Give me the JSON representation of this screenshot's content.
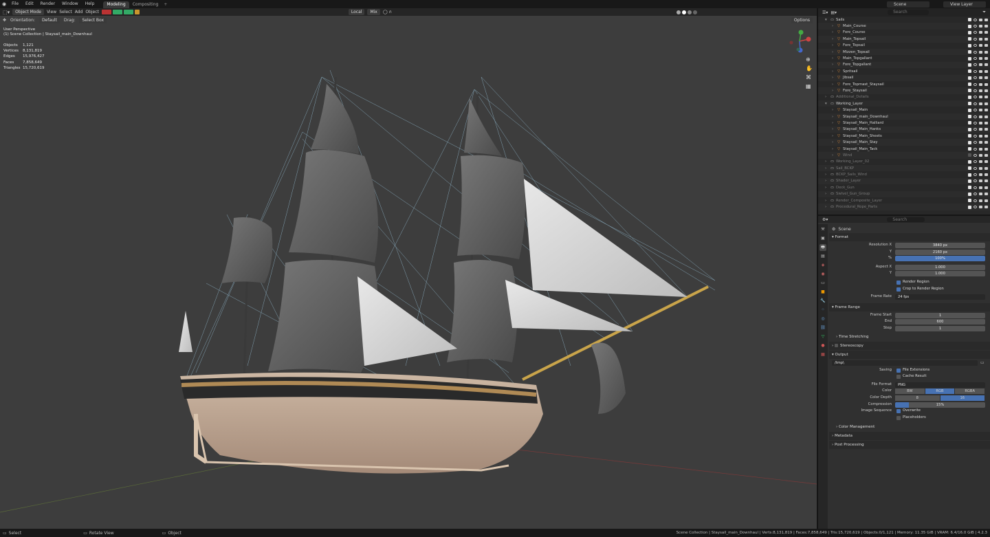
{
  "menubar": {
    "items": [
      "File",
      "Edit",
      "Render",
      "Window",
      "Help"
    ],
    "tabs": [
      "Modeling",
      "Compositing"
    ],
    "active_tab": "Modeling",
    "scene": "Scene",
    "view_layer": "View Layer"
  },
  "viewport_header": {
    "mode": "Object Mode",
    "menus": [
      "View",
      "Select",
      "Add",
      "Object"
    ],
    "transform": "Local",
    "pivot": "Mix",
    "orientation_label": "Orientation:",
    "orientation": "Default",
    "drag_label": "Drag:",
    "drag": "Select Box",
    "options": "Options"
  },
  "overlay": {
    "perspective": "User Perspective",
    "collection": "(1) Scene Collection | Staysail_main_Downhaul"
  },
  "stats": [
    {
      "k": "Objects",
      "v": "1,121"
    },
    {
      "k": "Vertices",
      "v": "8,131,819"
    },
    {
      "k": "Edges",
      "v": "15,976,427"
    },
    {
      "k": "Faces",
      "v": "7,858,649"
    },
    {
      "k": "Triangles",
      "v": "15,720,619"
    }
  ],
  "outliner": {
    "search_placeholder": "Search",
    "rows": [
      {
        "label": "Sails",
        "indent": 1,
        "dim": false
      },
      {
        "label": "Main_Course",
        "indent": 2,
        "dim": false
      },
      {
        "label": "Fore_Course",
        "indent": 2,
        "dim": false
      },
      {
        "label": "Main_Topsail",
        "indent": 2,
        "dim": false
      },
      {
        "label": "Fore_Topsail",
        "indent": 2,
        "dim": false
      },
      {
        "label": "Mizzen_Topsail",
        "indent": 2,
        "dim": false
      },
      {
        "label": "Main_Topgallant",
        "indent": 2,
        "dim": false
      },
      {
        "label": "Fore_Topgallant",
        "indent": 2,
        "dim": false
      },
      {
        "label": "Spritsail",
        "indent": 2,
        "dim": false
      },
      {
        "label": "Jibsail",
        "indent": 2,
        "dim": false
      },
      {
        "label": "Fore_Topmast_Staysail",
        "indent": 2,
        "dim": false
      },
      {
        "label": "Fore_Staysail",
        "indent": 2,
        "dim": false
      },
      {
        "label": "Additional_Details",
        "indent": 1,
        "dim": true
      },
      {
        "label": "Working_Layer",
        "indent": 1,
        "dim": false
      },
      {
        "label": "Staysail_Main",
        "indent": 2,
        "dim": false
      },
      {
        "label": "Staysail_main_Downhaul",
        "indent": 2,
        "dim": false
      },
      {
        "label": "Staysail_Main_Halliard",
        "indent": 2,
        "dim": false
      },
      {
        "label": "Staysail_Main_Hanks",
        "indent": 2,
        "dim": false
      },
      {
        "label": "Staysail_Main_Sheets",
        "indent": 2,
        "dim": false
      },
      {
        "label": "Staysail_Main_Stay",
        "indent": 2,
        "dim": false
      },
      {
        "label": "Staysail_Main_Tack",
        "indent": 2,
        "dim": false
      },
      {
        "label": "Wind",
        "indent": 2,
        "dim": true
      },
      {
        "label": "Working_Layer_02",
        "indent": 1,
        "dim": true
      },
      {
        "label": "Sail_BCKP",
        "indent": 1,
        "dim": true
      },
      {
        "label": "BCKP_Sails_Wind",
        "indent": 1,
        "dim": true
      },
      {
        "label": "Shader_Layer",
        "indent": 1,
        "dim": true
      },
      {
        "label": "Deck_Gun",
        "indent": 1,
        "dim": true
      },
      {
        "label": "Swivel_Gun_Group",
        "indent": 1,
        "dim": true
      },
      {
        "label": "Render_Composite_Layer",
        "indent": 1,
        "dim": true
      },
      {
        "label": "Procedural_Rope_Parts",
        "indent": 1,
        "dim": true
      }
    ]
  },
  "properties": {
    "search_placeholder": "Search",
    "scene": "Scene",
    "format": {
      "title": "Format",
      "res_x_label": "Resolution X",
      "res_x": "3840 px",
      "res_y_label": "Y",
      "res_y": "2160 px",
      "pct_label": "%",
      "pct": "100%",
      "aspect_x_label": "Aspect X",
      "aspect_x": "1.000",
      "aspect_y_label": "Y",
      "aspect_y": "1.000",
      "render_region": "Render Region",
      "crop": "Crop to Render Region",
      "frame_rate_label": "Frame Rate",
      "frame_rate": "24 fps"
    },
    "frame_range": {
      "title": "Frame Range",
      "start_label": "Frame Start",
      "start": "1",
      "end_label": "End",
      "end": "600",
      "step_label": "Step",
      "step": "1",
      "time_stretching": "Time Stretching"
    },
    "stereoscopy": "Stereoscopy",
    "output": {
      "title": "Output",
      "path": "/tmp\\",
      "saving_label": "Saving",
      "file_ext": "File Extensions",
      "cache": "Cache Result",
      "format_label": "File Format",
      "format": "PNG",
      "color_label": "Color",
      "color_opts": [
        "BW",
        "RGB",
        "RGBA"
      ],
      "color_sel": "RGB",
      "depth_label": "Color Depth",
      "depth_opts": [
        "8",
        "16"
      ],
      "depth_sel": "16",
      "compression_label": "Compression",
      "compression": "15%",
      "compression_value": 0.15,
      "seq_label": "Image Sequence",
      "overwrite": "Overwrite",
      "placeholders": "Placeholders",
      "color_mgmt": "Color Management"
    },
    "metadata": "Metadata",
    "post": "Post Processing"
  },
  "statusbar": {
    "select": "Select",
    "rotate": "Rotate View",
    "object": "Object",
    "info": "Scene Collection | Staysail_main_Downhaul | Verts:8,131,819 | Faces:7,858,649 | Tris:15,720,619 | Objects:0/1,121 | Memory: 11.35 GiB | VRAM: 6.4/16.0 GiB | 4.2.3"
  }
}
